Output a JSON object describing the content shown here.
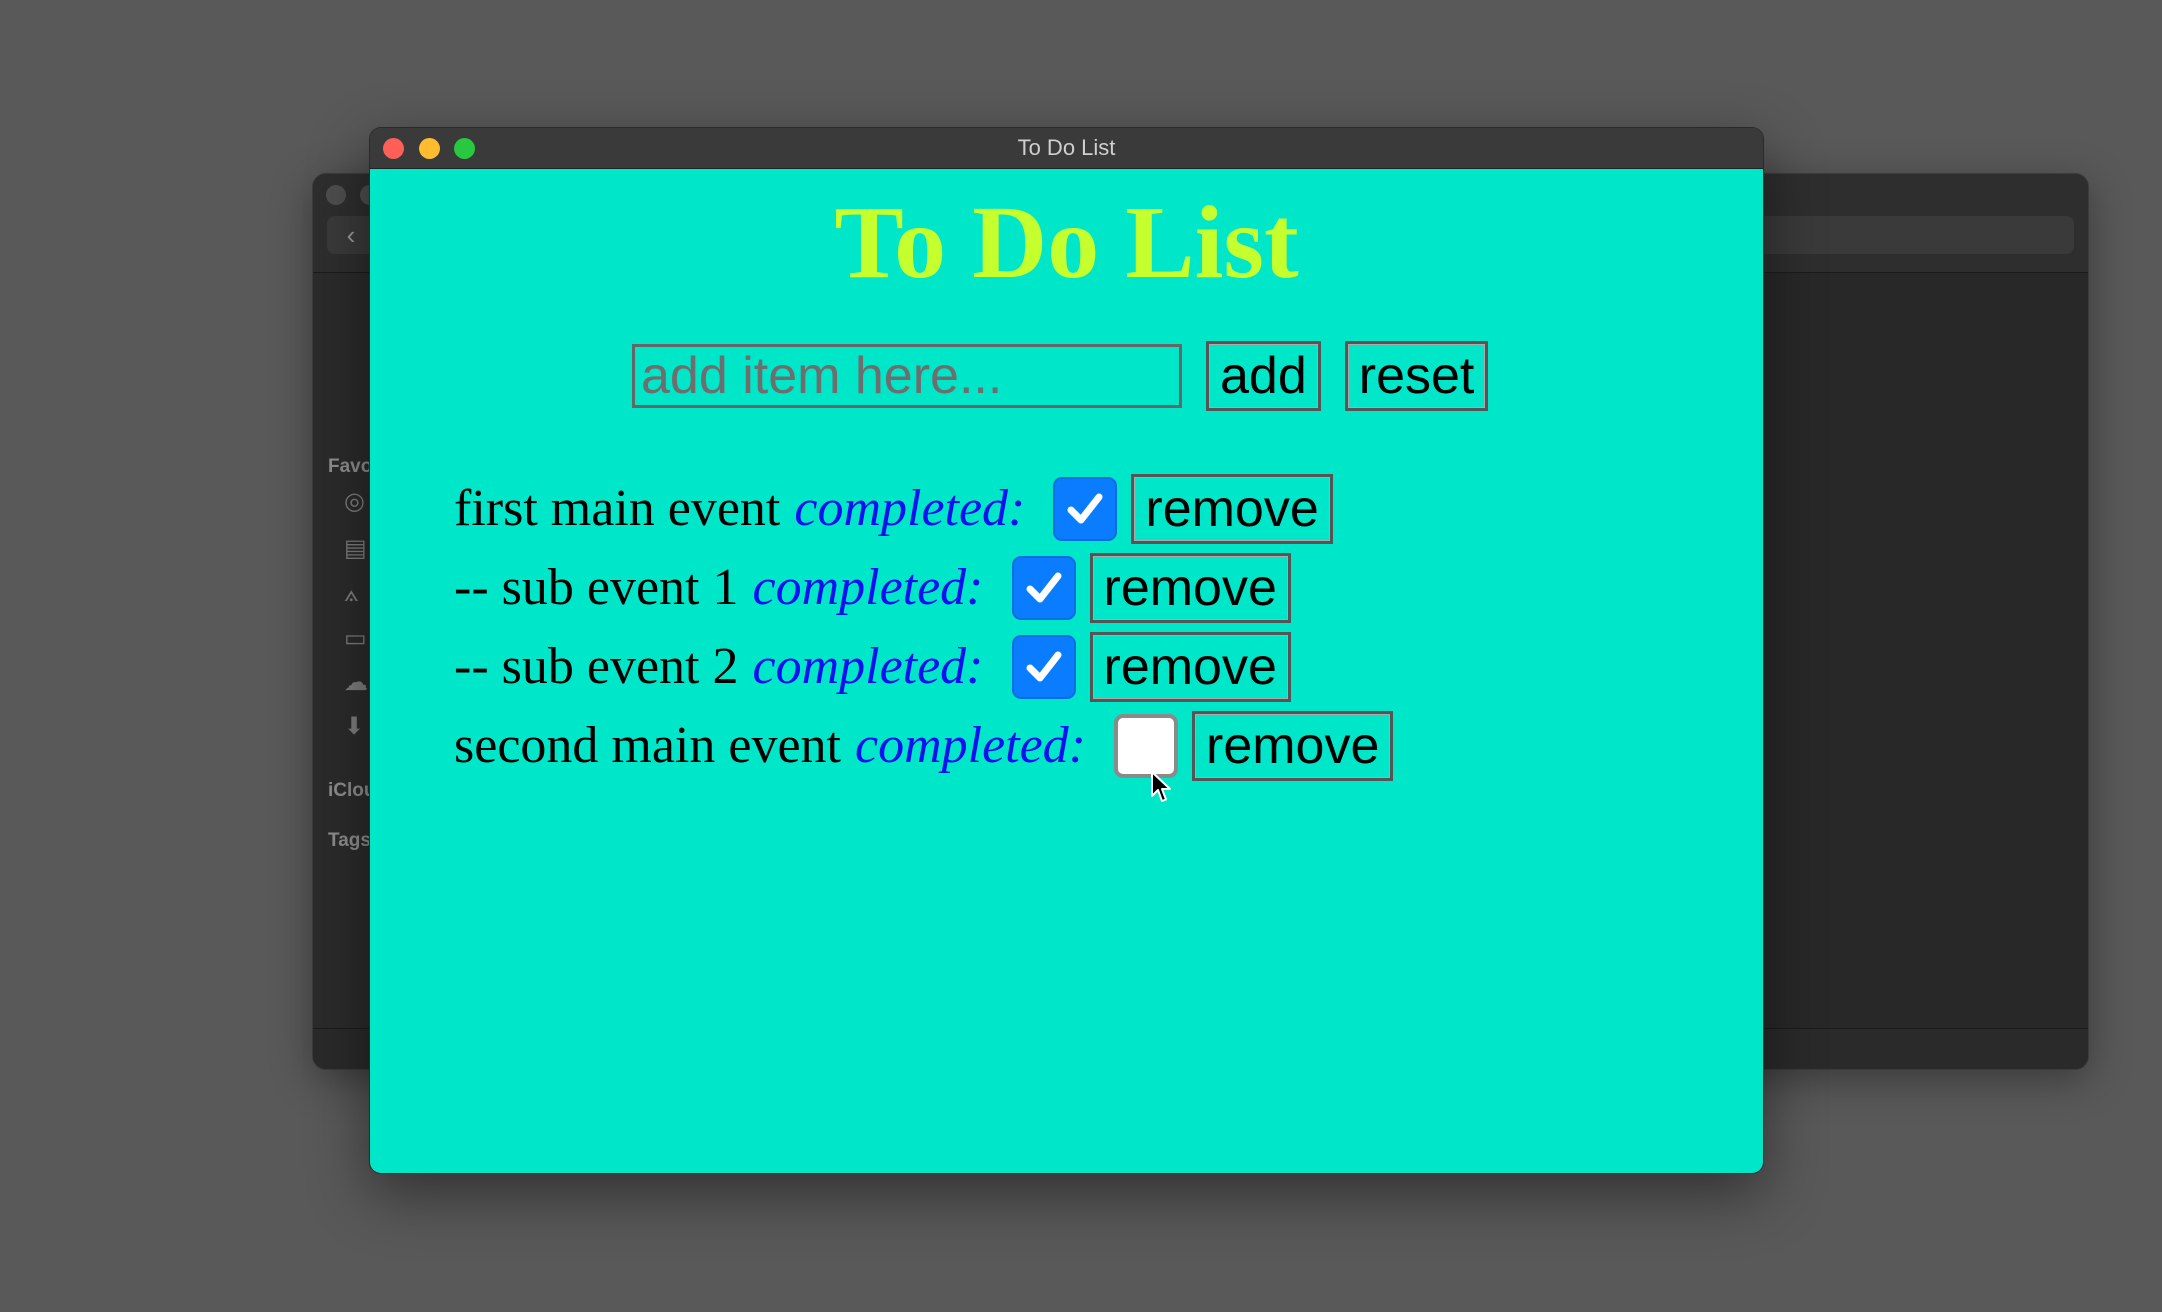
{
  "window": {
    "title": "To Do List"
  },
  "background_window": {
    "sidebar_headings": [
      "Favo",
      "iClou",
      "Tags"
    ]
  },
  "page": {
    "heading": "To Do List",
    "input_placeholder": "add item here...",
    "input_value": "",
    "add_label": "add",
    "reset_label": "reset"
  },
  "todos": [
    {
      "text": "first main event",
      "completed_label": "completed:",
      "checked": true,
      "remove_label": "remove"
    },
    {
      "text": "-- sub event 1",
      "completed_label": "completed:",
      "checked": true,
      "remove_label": "remove"
    },
    {
      "text": "-- sub event 2",
      "completed_label": "completed:",
      "checked": true,
      "remove_label": "remove"
    },
    {
      "text": "second main event",
      "completed_label": "completed:",
      "checked": false,
      "remove_label": "remove"
    }
  ],
  "colors": {
    "content_background": "#00e6c8",
    "heading": "#c6ff2e",
    "completed_label": "#1010f0",
    "checkbox_checked": "#0a7cff"
  },
  "icons": [
    "checkmark-icon",
    "mouse-pointer-icon"
  ]
}
